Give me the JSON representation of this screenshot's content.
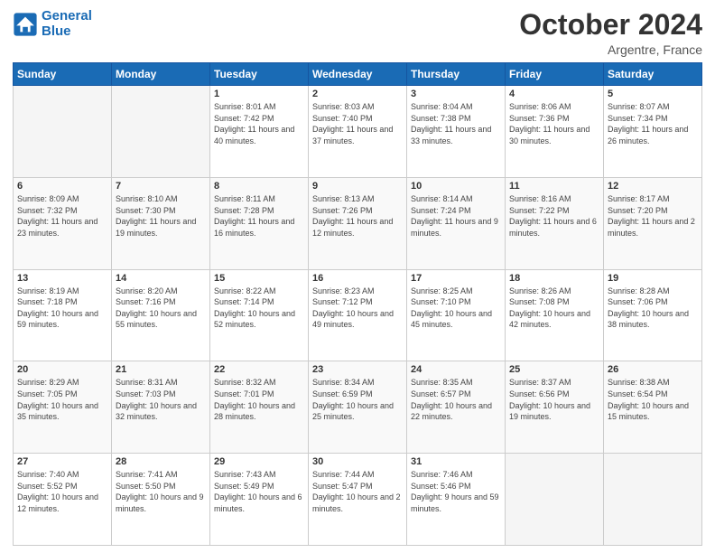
{
  "logo": {
    "line1": "General",
    "line2": "Blue"
  },
  "header": {
    "month": "October 2024",
    "location": "Argentre, France"
  },
  "weekdays": [
    "Sunday",
    "Monday",
    "Tuesday",
    "Wednesday",
    "Thursday",
    "Friday",
    "Saturday"
  ],
  "weeks": [
    [
      {
        "day": "",
        "info": ""
      },
      {
        "day": "",
        "info": ""
      },
      {
        "day": "1",
        "info": "Sunrise: 8:01 AM\nSunset: 7:42 PM\nDaylight: 11 hours and 40 minutes."
      },
      {
        "day": "2",
        "info": "Sunrise: 8:03 AM\nSunset: 7:40 PM\nDaylight: 11 hours and 37 minutes."
      },
      {
        "day": "3",
        "info": "Sunrise: 8:04 AM\nSunset: 7:38 PM\nDaylight: 11 hours and 33 minutes."
      },
      {
        "day": "4",
        "info": "Sunrise: 8:06 AM\nSunset: 7:36 PM\nDaylight: 11 hours and 30 minutes."
      },
      {
        "day": "5",
        "info": "Sunrise: 8:07 AM\nSunset: 7:34 PM\nDaylight: 11 hours and 26 minutes."
      }
    ],
    [
      {
        "day": "6",
        "info": "Sunrise: 8:09 AM\nSunset: 7:32 PM\nDaylight: 11 hours and 23 minutes."
      },
      {
        "day": "7",
        "info": "Sunrise: 8:10 AM\nSunset: 7:30 PM\nDaylight: 11 hours and 19 minutes."
      },
      {
        "day": "8",
        "info": "Sunrise: 8:11 AM\nSunset: 7:28 PM\nDaylight: 11 hours and 16 minutes."
      },
      {
        "day": "9",
        "info": "Sunrise: 8:13 AM\nSunset: 7:26 PM\nDaylight: 11 hours and 12 minutes."
      },
      {
        "day": "10",
        "info": "Sunrise: 8:14 AM\nSunset: 7:24 PM\nDaylight: 11 hours and 9 minutes."
      },
      {
        "day": "11",
        "info": "Sunrise: 8:16 AM\nSunset: 7:22 PM\nDaylight: 11 hours and 6 minutes."
      },
      {
        "day": "12",
        "info": "Sunrise: 8:17 AM\nSunset: 7:20 PM\nDaylight: 11 hours and 2 minutes."
      }
    ],
    [
      {
        "day": "13",
        "info": "Sunrise: 8:19 AM\nSunset: 7:18 PM\nDaylight: 10 hours and 59 minutes."
      },
      {
        "day": "14",
        "info": "Sunrise: 8:20 AM\nSunset: 7:16 PM\nDaylight: 10 hours and 55 minutes."
      },
      {
        "day": "15",
        "info": "Sunrise: 8:22 AM\nSunset: 7:14 PM\nDaylight: 10 hours and 52 minutes."
      },
      {
        "day": "16",
        "info": "Sunrise: 8:23 AM\nSunset: 7:12 PM\nDaylight: 10 hours and 49 minutes."
      },
      {
        "day": "17",
        "info": "Sunrise: 8:25 AM\nSunset: 7:10 PM\nDaylight: 10 hours and 45 minutes."
      },
      {
        "day": "18",
        "info": "Sunrise: 8:26 AM\nSunset: 7:08 PM\nDaylight: 10 hours and 42 minutes."
      },
      {
        "day": "19",
        "info": "Sunrise: 8:28 AM\nSunset: 7:06 PM\nDaylight: 10 hours and 38 minutes."
      }
    ],
    [
      {
        "day": "20",
        "info": "Sunrise: 8:29 AM\nSunset: 7:05 PM\nDaylight: 10 hours and 35 minutes."
      },
      {
        "day": "21",
        "info": "Sunrise: 8:31 AM\nSunset: 7:03 PM\nDaylight: 10 hours and 32 minutes."
      },
      {
        "day": "22",
        "info": "Sunrise: 8:32 AM\nSunset: 7:01 PM\nDaylight: 10 hours and 28 minutes."
      },
      {
        "day": "23",
        "info": "Sunrise: 8:34 AM\nSunset: 6:59 PM\nDaylight: 10 hours and 25 minutes."
      },
      {
        "day": "24",
        "info": "Sunrise: 8:35 AM\nSunset: 6:57 PM\nDaylight: 10 hours and 22 minutes."
      },
      {
        "day": "25",
        "info": "Sunrise: 8:37 AM\nSunset: 6:56 PM\nDaylight: 10 hours and 19 minutes."
      },
      {
        "day": "26",
        "info": "Sunrise: 8:38 AM\nSunset: 6:54 PM\nDaylight: 10 hours and 15 minutes."
      }
    ],
    [
      {
        "day": "27",
        "info": "Sunrise: 7:40 AM\nSunset: 5:52 PM\nDaylight: 10 hours and 12 minutes."
      },
      {
        "day": "28",
        "info": "Sunrise: 7:41 AM\nSunset: 5:50 PM\nDaylight: 10 hours and 9 minutes."
      },
      {
        "day": "29",
        "info": "Sunrise: 7:43 AM\nSunset: 5:49 PM\nDaylight: 10 hours and 6 minutes."
      },
      {
        "day": "30",
        "info": "Sunrise: 7:44 AM\nSunset: 5:47 PM\nDaylight: 10 hours and 2 minutes."
      },
      {
        "day": "31",
        "info": "Sunrise: 7:46 AM\nSunset: 5:46 PM\nDaylight: 9 hours and 59 minutes."
      },
      {
        "day": "",
        "info": ""
      },
      {
        "day": "",
        "info": ""
      }
    ]
  ]
}
